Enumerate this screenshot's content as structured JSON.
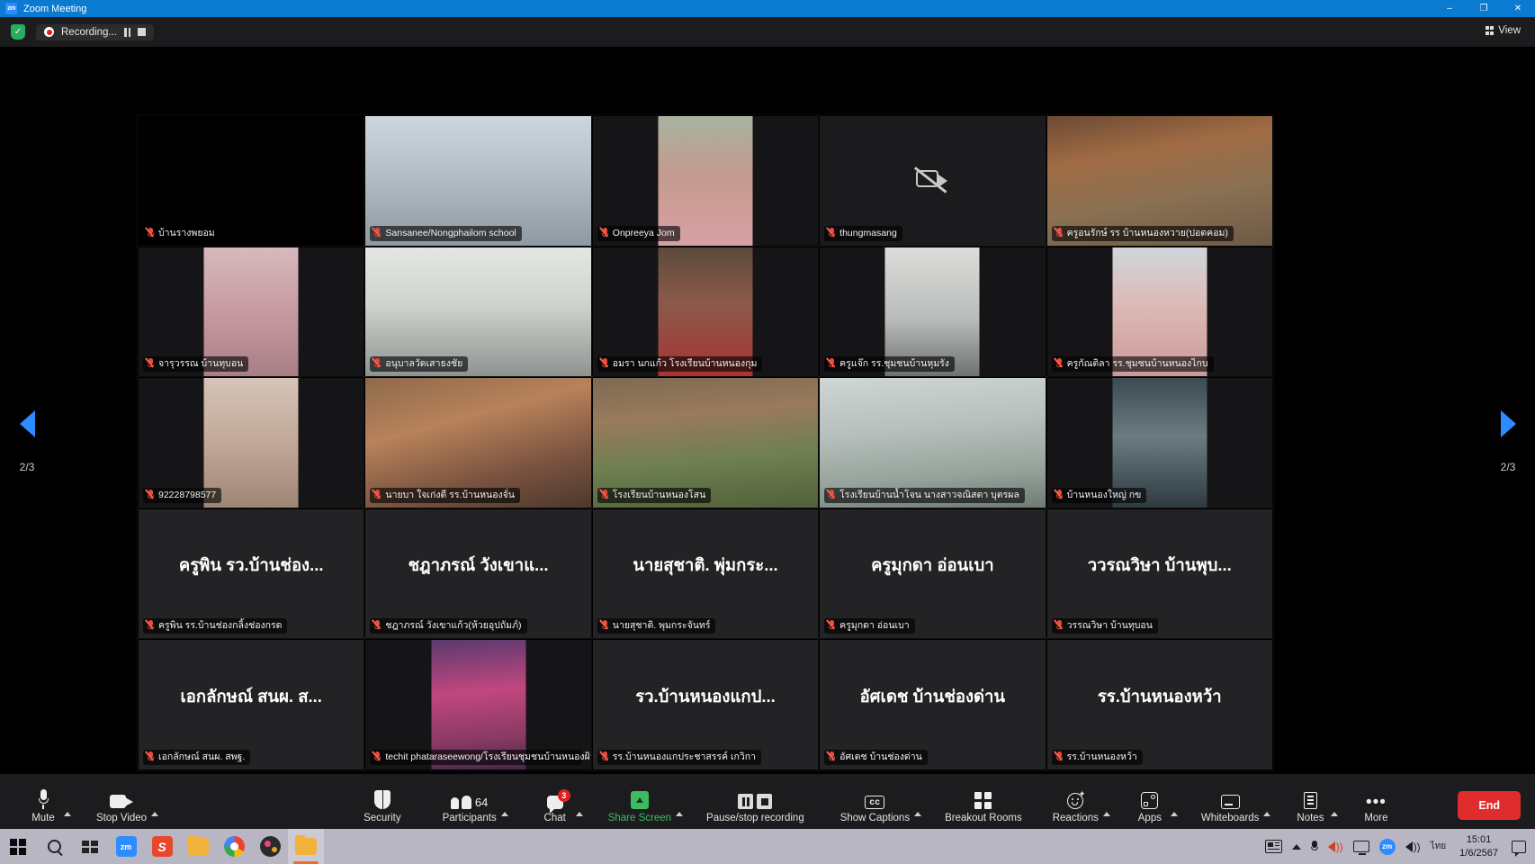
{
  "window": {
    "title": "Zoom Meeting",
    "app_badge": "zm",
    "minimize": "–",
    "maximize": "❐",
    "close": "✕"
  },
  "header": {
    "encryption_icon": "shield-check-icon",
    "encryption_glyph": "✓",
    "recording_label": "Recording...",
    "pause_recording_icon": "pause-icon",
    "stop_recording_icon": "stop-icon",
    "view_label": "View",
    "view_icon": "grid-view-icon"
  },
  "pagination": {
    "left_label": "2/3",
    "right_label": "2/3",
    "left_arrow_icon": "chevron-left-icon",
    "right_arrow_icon": "chevron-right-icon"
  },
  "gallery": {
    "tiles": [
      {
        "name": "บ้านรางพยอม",
        "muted": true,
        "kind": "black"
      },
      {
        "name": "Sansanee/Nongphailom school",
        "muted": true,
        "kind": "video",
        "video": "classroom-woman-white"
      },
      {
        "name": "Onpreeya Jom",
        "muted": true,
        "kind": "portrait",
        "video": "woman-pink-green-wall"
      },
      {
        "name": "thungmasang",
        "muted": true,
        "kind": "camoff"
      },
      {
        "name": "ครูอนรักษ์ รร บ้านหนองหวาย(ปอดคอม)",
        "muted": true,
        "kind": "video",
        "video": "man-barn-orange"
      },
      {
        "name": "จารุวรรณ บ้านทุบอน",
        "muted": true,
        "kind": "portrait",
        "video": "woman-pink-room"
      },
      {
        "name": "อนุบาลวัดเสาธงชัย",
        "muted": true,
        "kind": "video",
        "video": "man-white-wall"
      },
      {
        "name": "อมรา นกแก้ว โรงเรียนบ้านหนองกุม",
        "muted": true,
        "kind": "portrait",
        "video": "woman-red-shirt"
      },
      {
        "name": "ครูแจ๊ก รร.ชุมชนบ้านหุมรัง",
        "muted": true,
        "kind": "portrait",
        "video": "man-grey-wall"
      },
      {
        "name": "ครูกัณติลา รร.ชุมชนบ้านหนองไกบ",
        "muted": true,
        "kind": "portrait",
        "video": "woman-pink-indoor"
      },
      {
        "name": "92228798577",
        "muted": true,
        "kind": "portrait",
        "video": "woman-glasses-room"
      },
      {
        "name": "นายบา ใจเก่งดี รร.บ้านหนองจั่น",
        "muted": true,
        "kind": "video",
        "video": "woman-orange-room"
      },
      {
        "name": "โรงเรียนบ้านหนองโสน",
        "muted": true,
        "kind": "video",
        "video": "man-closeup-outdoor"
      },
      {
        "name": "โรงเรียนบ้านน้ำโจน นางสาวจณิสตา  บุตรผล",
        "muted": true,
        "kind": "video",
        "video": "woman-outdoor-bright"
      },
      {
        "name": "บ้านหนองใหญ่ กข",
        "muted": true,
        "kind": "portrait",
        "video": "woman-car-dark"
      },
      {
        "name": "ครูพิน รร.บ้านช่องกลิ้งช่องกรด",
        "muted": true,
        "kind": "avatar",
        "display_name": "ครูพิน รว.บ้านช่อง..."
      },
      {
        "name": "ชฎาภรณ์ วังเขาแก้ว(ห้วยอุปถัมภ์)",
        "muted": true,
        "kind": "avatar",
        "display_name": "ชฎาภรณ์ วังเขาแ..."
      },
      {
        "name": "นายสุชาติ. พุมกระจันทร์",
        "muted": true,
        "kind": "avatar",
        "display_name": "นายสุชาติ. พุ่มกระ..."
      },
      {
        "name": "ครูมุกดา อ่อนเบา",
        "muted": true,
        "kind": "avatar",
        "display_name": "ครูมุกดา อ่อนเบา"
      },
      {
        "name": "วรรณวิษา บ้านทุบอน",
        "muted": true,
        "kind": "avatar",
        "display_name": "ววรณวิษา บ้านพุบ..."
      },
      {
        "name": "เอกลักษณ์ สนผ. สพฐ.",
        "muted": true,
        "kind": "avatar",
        "display_name": "เอกลักษณ์ สนผ. ส..."
      },
      {
        "name": "techit phataraseewong/โรงเรียนชุมชนบ้านหนองฝ้าย",
        "muted": true,
        "kind": "portrait",
        "video": "man-pink-shirt-office"
      },
      {
        "name": "รร.บ้านหนองแกประชาสรรค์ เกวิกา",
        "muted": true,
        "kind": "avatar",
        "display_name": "รว.บ้านหนองแกป..."
      },
      {
        "name": "อัศเดช บ้านช่องด่าน",
        "muted": true,
        "kind": "avatar",
        "display_name": "อัศเดช บ้านช่องด่าน"
      },
      {
        "name": "รร.บ้านหนองหว้า",
        "muted": true,
        "kind": "avatar",
        "display_name": "รร.บ้านหนองหว้า"
      }
    ]
  },
  "toolbar": {
    "mute_label": "Mute",
    "stop_video_label": "Stop Video",
    "security_label": "Security",
    "participants_label": "Participants",
    "participants_count": "64",
    "chat_label": "Chat",
    "chat_badge": "3",
    "share_screen_label": "Share Screen",
    "pause_stop_recording_label": "Pause/stop recording",
    "show_captions_label": "Show Captions",
    "captions_glyph": "cc",
    "breakout_rooms_label": "Breakout Rooms",
    "reactions_label": "Reactions",
    "apps_label": "Apps",
    "whiteboards_label": "Whiteboards",
    "notes_label": "Notes",
    "more_label": "More",
    "more_glyph": "•••",
    "end_label": "End",
    "accent_green": "#3dbb61",
    "end_red": "#e02c2c",
    "badge_red": "#e02020"
  },
  "taskbar": {
    "start_icon": "windows-start-icon",
    "search_icon": "search-icon",
    "task_view_icon": "task-view-icon",
    "pinned": [
      {
        "icon": "zoom-app-icon",
        "glyph": "zm"
      },
      {
        "icon": "s-app-icon",
        "glyph": "S"
      },
      {
        "icon": "file-explorer-icon",
        "glyph": ""
      },
      {
        "icon": "chrome-icon",
        "glyph": ""
      },
      {
        "icon": "media-app-icon",
        "glyph": ""
      },
      {
        "icon": "folder-active-icon",
        "glyph": ""
      }
    ],
    "tray": {
      "news_icon": "news-weather-icon",
      "show_hidden_icon": "chevron-up-icon",
      "mic_icon": "microphone-icon",
      "speaker_muted_icon": "speaker-active-icon",
      "monitor_icon": "display-icon",
      "zoom_tray_icon": "zoom-tray-icon",
      "zoom_tray_glyph": "zm",
      "volume_icon": "volume-icon",
      "language": "ไทย",
      "time": "15:01",
      "date": "1/6/2567",
      "notifications_icon": "notification-icon"
    }
  }
}
